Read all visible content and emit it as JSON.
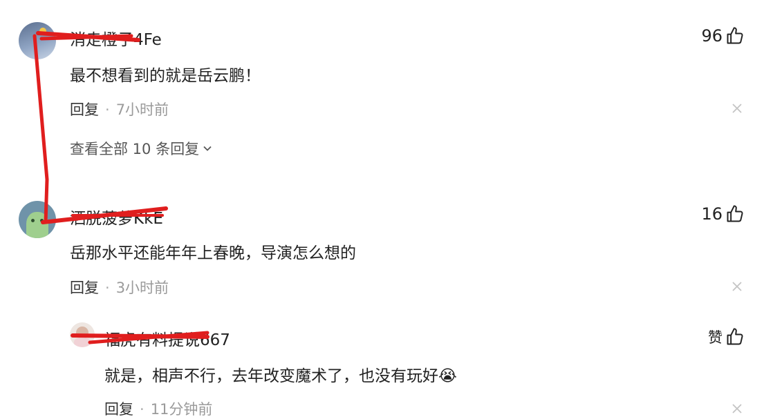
{
  "comments": [
    {
      "username": "消走橙子4Fe",
      "content": "最不想看到的就是岳云鹏！",
      "reply_label": "回复",
      "separator": "·",
      "time": "7小时前",
      "likes": "96",
      "view_all": "查看全部 10 条回复"
    },
    {
      "username": "洒脱菠萝KkE",
      "content": "岳那水平还能年年上春晚，导演怎么想的",
      "reply_label": "回复",
      "separator": "·",
      "time": "3小时前",
      "likes": "16",
      "replies": [
        {
          "username": "福虎有料提说667",
          "content": "就是，相声不行，去年改变魔术了，也没有玩好",
          "emoji": "😭",
          "reply_label": "回复",
          "separator": "·",
          "time": "11分钟前",
          "likes": "赞"
        }
      ]
    }
  ],
  "colors": {
    "annotation_red": "#e01e1e",
    "muted": "#9a9a9a"
  }
}
